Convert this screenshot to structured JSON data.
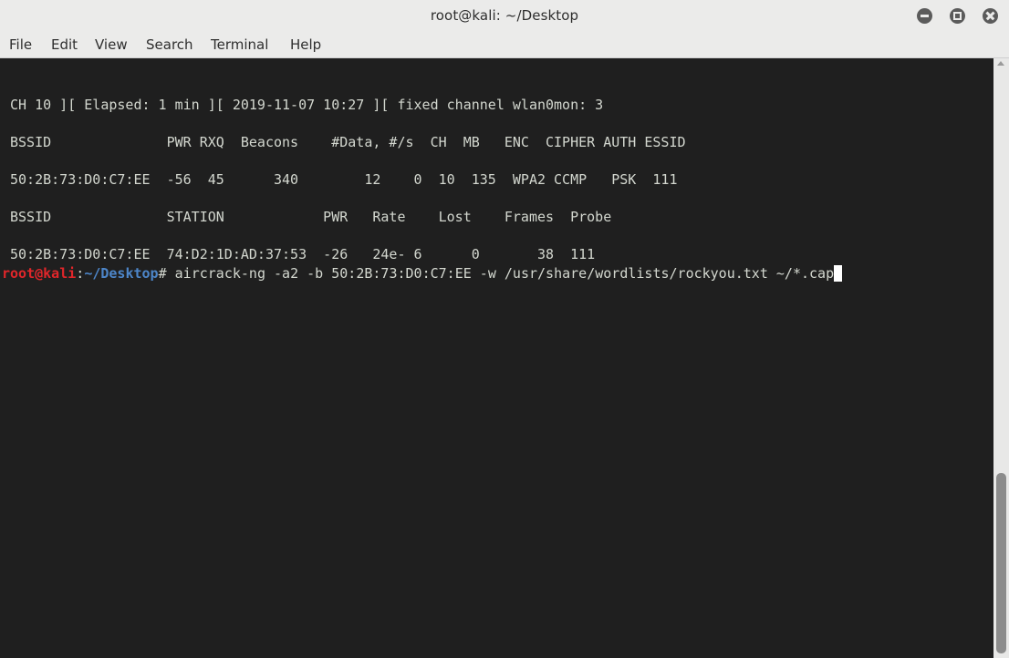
{
  "window": {
    "title": "root@kali: ~/Desktop"
  },
  "menubar": {
    "items": [
      "File",
      "Edit",
      "View",
      "Search",
      "Terminal",
      "Help"
    ]
  },
  "terminal": {
    "status_line": "CH 10 ][ Elapsed: 1 min ][ 2019-11-07 10:27 ][ fixed channel wlan0mon: 3",
    "ap_header": "BSSID              PWR RXQ  Beacons    #Data, #/s  CH  MB   ENC  CIPHER AUTH ESSID",
    "ap_row": "50:2B:73:D0:C7:EE  -56  45      340        12    0  10  135  WPA2 CCMP   PSK  111",
    "station_header": "BSSID              STATION            PWR   Rate    Lost    Frames  Probe",
    "station_row": "50:2B:73:D0:C7:EE  74:D2:1D:AD:37:53  -26   24e- 6      0       38  111",
    "prompt": {
      "user_host": "root@kali",
      "colon": ":",
      "path": "~/Desktop",
      "symbol": "#",
      "command": " aircrack-ng -a2 -b 50:2B:73:D0:C7:EE -w /usr/share/wordlists/rockyou.txt ~/*.cap"
    }
  },
  "icons": {
    "minimize": "minimize-icon",
    "maximize": "maximize-icon",
    "close": "close-icon"
  },
  "colors": {
    "terminal_bg": "#1f1f1f",
    "prompt_user": "#e0262a",
    "prompt_path": "#4d86c9"
  }
}
